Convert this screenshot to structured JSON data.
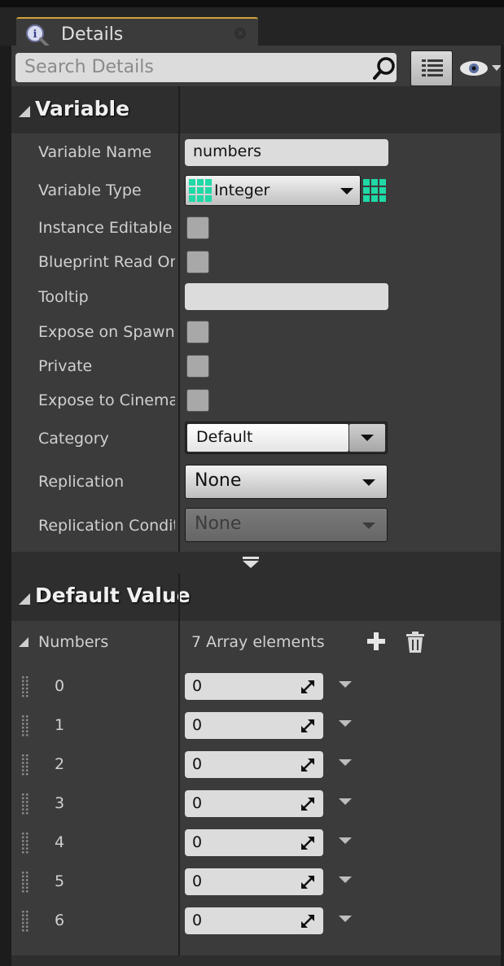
{
  "tab": {
    "title": "Details",
    "icon": "details-magnifier-icon",
    "close": "×"
  },
  "search": {
    "placeholder": "Search Details"
  },
  "variable_section": {
    "title": "Variable",
    "properties": {
      "name_label": "Variable Name",
      "name_value": "numbers",
      "type_label": "Variable Type",
      "type_value": "Integer",
      "instance_editable_label": "Instance Editable",
      "blueprint_read_only_label": "Blueprint Read Only",
      "tooltip_label": "Tooltip",
      "tooltip_value": "",
      "expose_on_spawn_label": "Expose on Spawn",
      "private_label": "Private",
      "expose_to_cinematics_label": "Expose to Cinematics",
      "category_label": "Category",
      "category_value": "Default",
      "replication_label": "Replication",
      "replication_value": "None",
      "replication_condition_label": "Replication Condition",
      "replication_condition_value": "None"
    },
    "checkboxes": {
      "instance_editable": false,
      "blueprint_read_only": false,
      "expose_on_spawn": false,
      "private": false,
      "expose_to_cinematics": false
    }
  },
  "default_value_section": {
    "title": "Default Value",
    "array_label": "Numbers",
    "array_count_text": "7 Array elements",
    "elements": [
      {
        "index": "0",
        "value": "0"
      },
      {
        "index": "1",
        "value": "0"
      },
      {
        "index": "2",
        "value": "0"
      },
      {
        "index": "3",
        "value": "0"
      },
      {
        "index": "4",
        "value": "0"
      },
      {
        "index": "5",
        "value": "0"
      },
      {
        "index": "6",
        "value": "0"
      }
    ]
  },
  "colors": {
    "integer_type": "#1fd9a6",
    "tab_accent": "#d1a13b"
  }
}
